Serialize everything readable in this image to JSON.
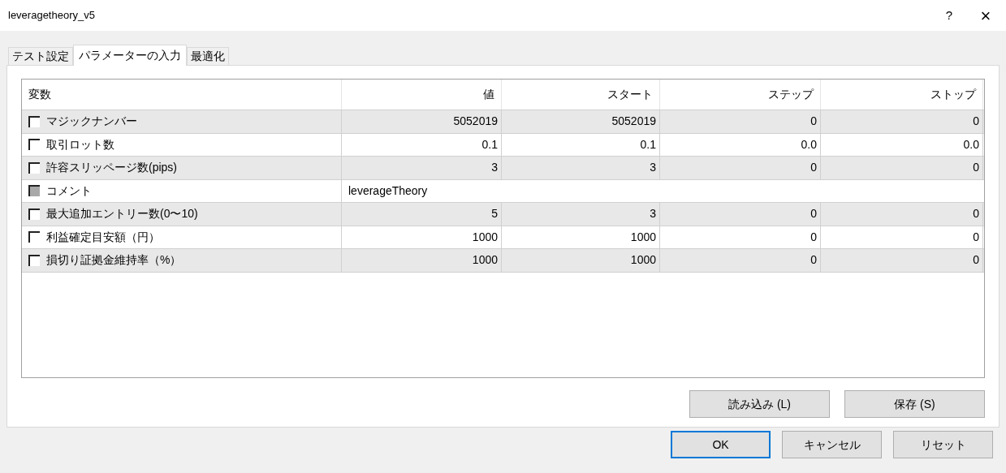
{
  "window": {
    "title": "leveragetheory_v5",
    "help": "?",
    "close": "×"
  },
  "tabs": [
    {
      "label": "テスト設定",
      "selected": false
    },
    {
      "label": "パラメーターの入力",
      "selected": true
    },
    {
      "label": "最適化",
      "selected": false
    }
  ],
  "table": {
    "columns": [
      "変数",
      "値",
      "スタート",
      "ステップ",
      "ストップ"
    ],
    "rows": [
      {
        "kind": "range",
        "name": "マジックナンバー",
        "checked": false,
        "disabled": false,
        "value": "5052019",
        "start": "5052019",
        "step": "0",
        "stop": "0"
      },
      {
        "kind": "range",
        "name": "取引ロット数",
        "checked": false,
        "disabled": false,
        "value": "0.1",
        "start": "0.1",
        "step": "0.0",
        "stop": "0.0"
      },
      {
        "kind": "range",
        "name": "許容スリッページ数(pips)",
        "checked": false,
        "disabled": false,
        "value": "3",
        "start": "3",
        "step": "0",
        "stop": "0"
      },
      {
        "kind": "text",
        "name": "コメント",
        "checked": false,
        "disabled": true,
        "value": "leverageTheory"
      },
      {
        "kind": "range",
        "name": "最大追加エントリー数(0〜10)",
        "checked": false,
        "disabled": false,
        "value": "5",
        "start": "3",
        "step": "0",
        "stop": "0"
      },
      {
        "kind": "range",
        "name": "利益確定目安額（円）",
        "checked": false,
        "disabled": false,
        "value": "1000",
        "start": "1000",
        "step": "0",
        "stop": "0"
      },
      {
        "kind": "range",
        "name": "損切り証拠金維持率（%）",
        "checked": false,
        "disabled": false,
        "value": "1000",
        "start": "1000",
        "step": "0",
        "stop": "0"
      }
    ]
  },
  "panel_buttons": [
    {
      "label": "読み込み (L)"
    },
    {
      "label": "保存 (S)"
    }
  ],
  "dialog_buttons": [
    {
      "label": "OK",
      "default": true
    },
    {
      "label": "キャンセル",
      "default": false
    },
    {
      "label": "リセット",
      "default": false
    }
  ]
}
